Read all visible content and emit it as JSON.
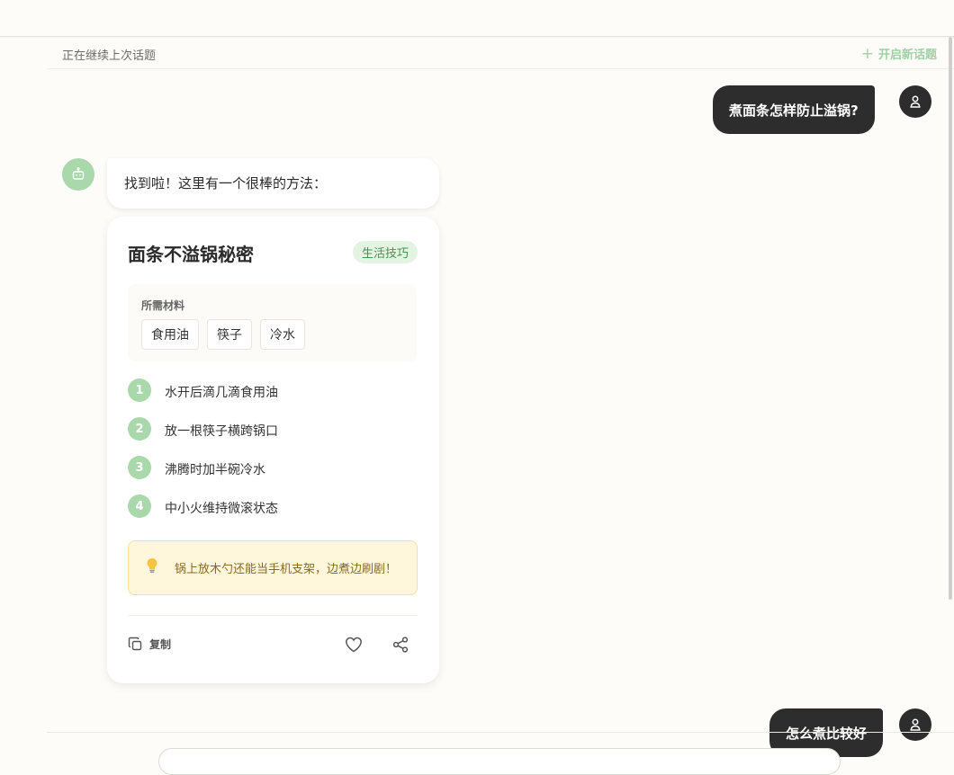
{
  "header": {
    "status_text": "正在继续上次话题",
    "new_topic_label": "开启新话题"
  },
  "messages": {
    "user_1": "煮面条怎样防止溢锅?",
    "bot_1": "找到啦！这里有一个很棒的方法：",
    "user_2": "怎么煮比较好"
  },
  "card": {
    "title": "面条不溢锅秘密",
    "tag": "生活技巧",
    "materials_label": "所需材料",
    "materials": [
      "食用油",
      "筷子",
      "冷水"
    ],
    "steps": [
      {
        "num": "1",
        "text": "水开后滴几滴食用油"
      },
      {
        "num": "2",
        "text": "放一根筷子横跨锅口"
      },
      {
        "num": "3",
        "text": "沸腾时加半碗冷水"
      },
      {
        "num": "4",
        "text": "中小火维持微滚状态"
      }
    ],
    "tip": "锅上放木勺还能当手机支架，边煮边刷剧！",
    "copy_label": "复制"
  },
  "colors": {
    "accent_green": "#a9d8ab",
    "user_bubble": "#2d2d2d",
    "tip_bg": "#fff7dc"
  },
  "icons": {
    "user_avatar": "user-icon",
    "bot_avatar": "robot-icon",
    "copy": "copy-icon",
    "like": "heart-icon",
    "share": "share-icon",
    "tip": "lightbulb-icon"
  }
}
